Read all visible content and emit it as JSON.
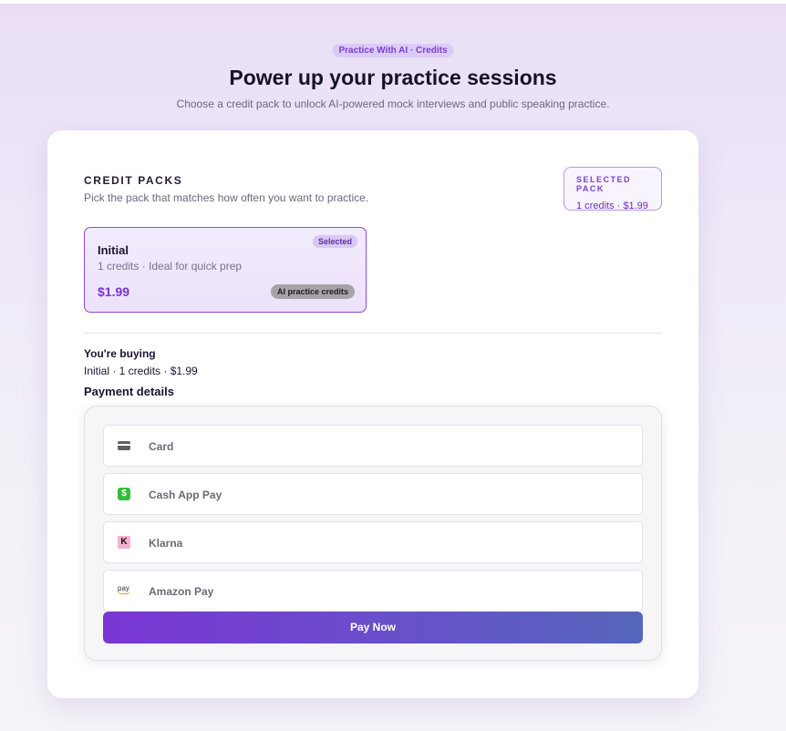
{
  "header": {
    "eyebrow": "Practice With AI · Credits",
    "title": "Power up your practice sessions",
    "subtitle": "Choose a credit pack to unlock AI-powered mock interviews and public speaking practice."
  },
  "packs": {
    "heading": "CREDIT PACKS",
    "subheading": "Pick the pack that matches how often you want to practice.",
    "selected_label": "SELECTED PACK",
    "selected_value": "1 credits · $1.99",
    "items": [
      {
        "name": "Initial",
        "description": "1 credits · Ideal for quick prep",
        "price": "$1.99",
        "badge": "Selected",
        "tag": "AI practice credits"
      }
    ]
  },
  "summary": {
    "buying_label": "You're buying",
    "buying_value": "Initial · 1 credits · $1.99",
    "payment_label": "Payment details"
  },
  "payment": {
    "methods": [
      {
        "label": "Card",
        "icon": "credit-card-icon"
      },
      {
        "label": "Cash App Pay",
        "icon": "cash-app-icon"
      },
      {
        "label": "Klarna",
        "icon": "klarna-icon"
      },
      {
        "label": "Amazon Pay",
        "icon": "amazon-pay-icon"
      }
    ],
    "pay_button": "Pay Now"
  },
  "colors": {
    "accent": "#7a34cf",
    "button_gradient_start": "#7a35d4",
    "button_gradient_end": "#5566bb"
  }
}
